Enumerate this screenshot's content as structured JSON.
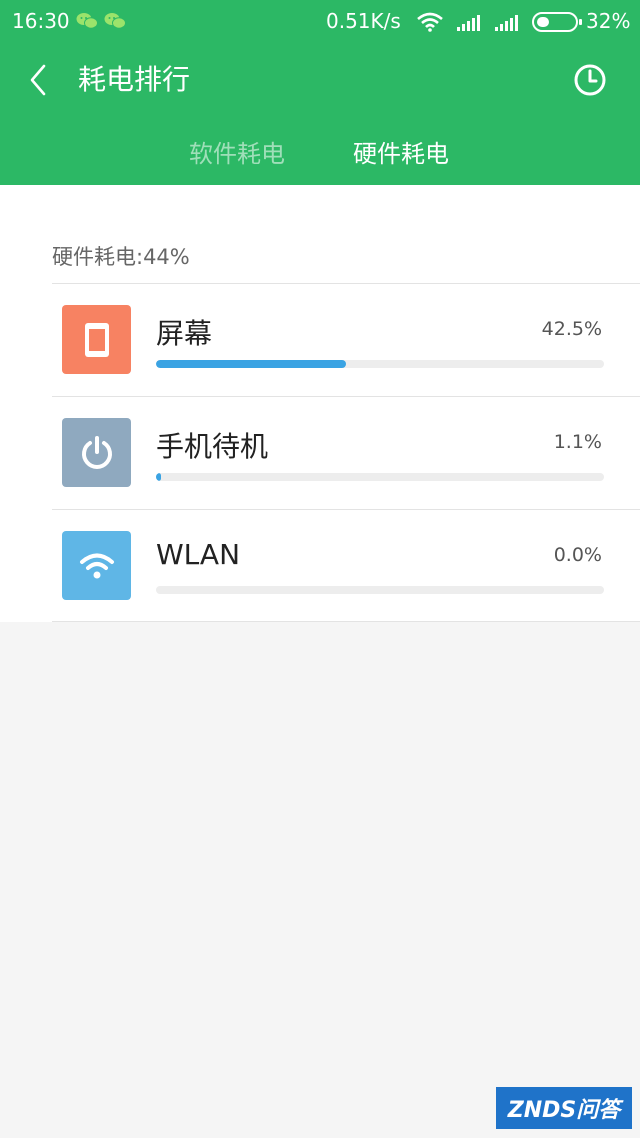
{
  "status_bar": {
    "time": "16:30",
    "network_speed": "0.51K/s",
    "battery": "32%"
  },
  "header": {
    "title": "耗电排行",
    "tabs": [
      {
        "label": "软件耗电",
        "active": false
      },
      {
        "label": "硬件耗电",
        "active": true
      }
    ]
  },
  "summary": "硬件耗电:44%",
  "items": [
    {
      "label": "屏幕",
      "percent_text": "42.5%",
      "value": 42.5,
      "icon": "phone-screen-icon",
      "color": "#f78262"
    },
    {
      "label": "手机待机",
      "percent_text": "1.1%",
      "value": 1.1,
      "icon": "power-icon",
      "color": "#8fa9bf"
    },
    {
      "label": "WLAN",
      "percent_text": "0.0%",
      "value": 0.0,
      "icon": "wifi-icon",
      "color": "#5fb6e6"
    }
  ],
  "watermark": "ZNDS问答",
  "colors": {
    "header_bg": "#2cb865",
    "bar": "#3aa3e3"
  }
}
